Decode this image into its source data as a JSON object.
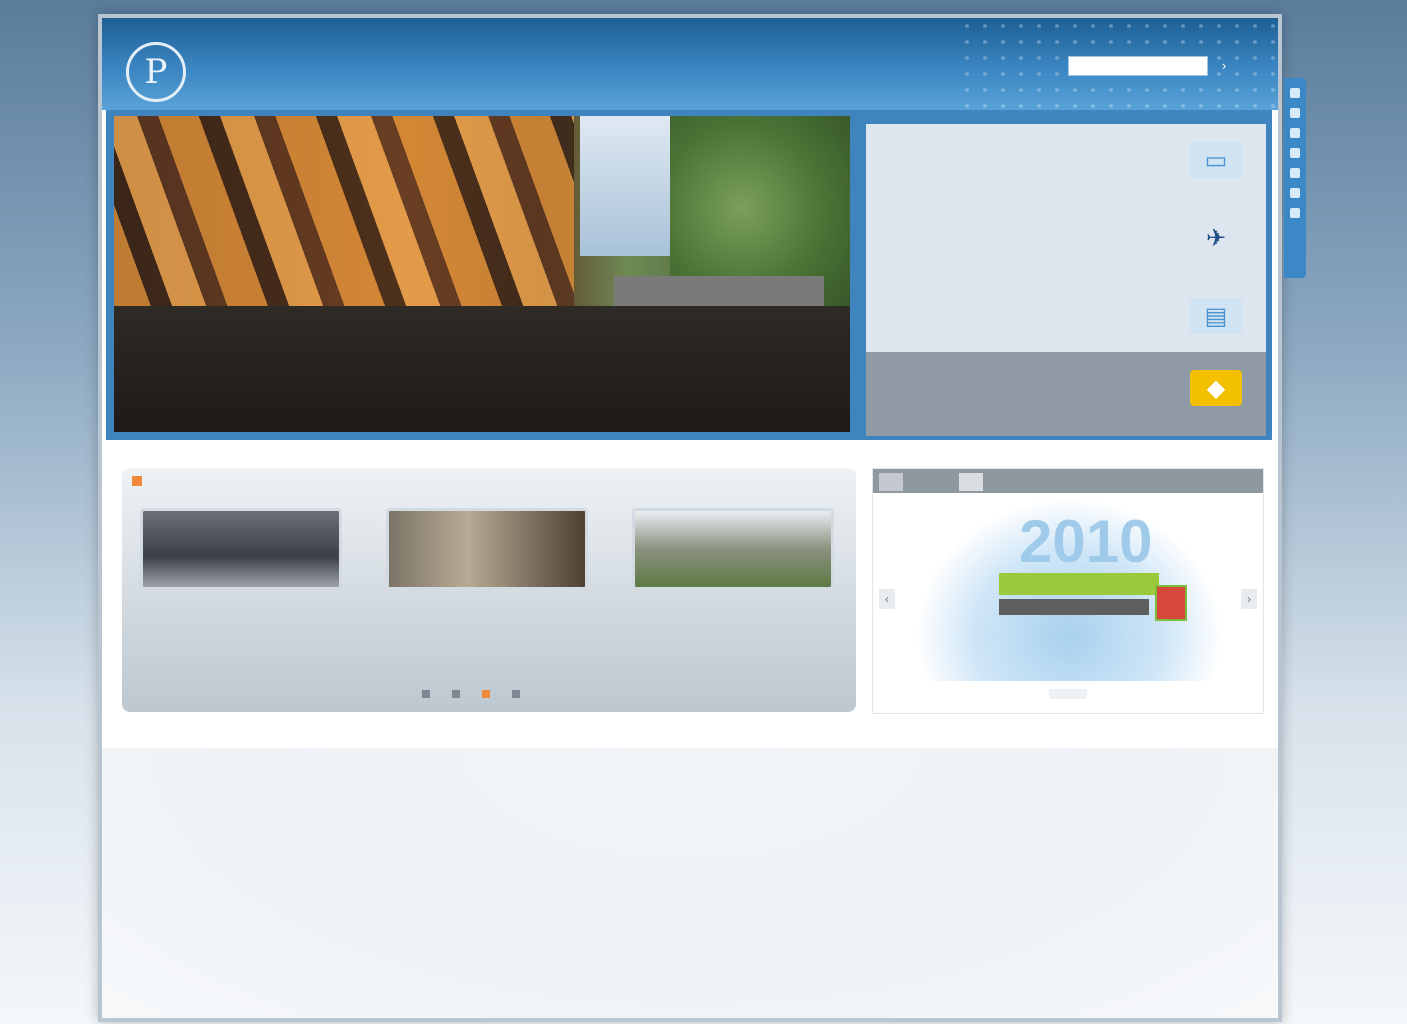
{
  "header": {
    "logo_glyph": "P",
    "logo_text": "",
    "nav": [
      "",
      "",
      "",
      "",
      "",
      ""
    ],
    "search_placeholder": "",
    "search_button": "›"
  },
  "hero": {
    "small_label": "",
    "title": "",
    "subtitle": "",
    "features": [
      {
        "title": "",
        "text": "",
        "icon": "computer-icon"
      },
      {
        "title": "",
        "text": "",
        "icon": "plane-icon"
      },
      {
        "title": "",
        "text": "",
        "icon": "building-icon"
      },
      {
        "title": "",
        "text": "",
        "icon": "tag-icon"
      }
    ]
  },
  "news": {
    "heading": "",
    "view_all": "",
    "items": [
      {
        "title": "",
        "text": ""
      },
      {
        "title": "",
        "text": ""
      },
      {
        "title": "",
        "text": ""
      }
    ]
  },
  "promo": {
    "tabs": [
      "",
      ""
    ],
    "year": "2010",
    "banner": "",
    "prev": "‹",
    "next": "›"
  },
  "footer": {
    "columns": [
      {
        "title": "",
        "items": [
          "",
          "",
          "",
          "",
          "",
          "",
          ""
        ]
      },
      {
        "title": "",
        "items": [
          "",
          "",
          "",
          "",
          ""
        ]
      },
      {
        "title": "",
        "items": [
          "",
          "",
          "",
          "",
          ""
        ]
      },
      {
        "title": "",
        "items": [
          "",
          "",
          "",
          "",
          "",
          ""
        ]
      },
      {
        "title": "",
        "items": [
          "",
          "",
          "",
          "",
          "",
          ""
        ]
      },
      {
        "title": "",
        "items": [
          "",
          "",
          "",
          "",
          "",
          ""
        ]
      }
    ],
    "copyright": "",
    "links": [
      "",
      "",
      "",
      "",
      ""
    ]
  },
  "colors": {
    "brand_blue": "#3b86c2",
    "accent_orange": "#f08a3a",
    "title_yellow": "#f2c000",
    "link_blue": "#1f5fa0"
  }
}
